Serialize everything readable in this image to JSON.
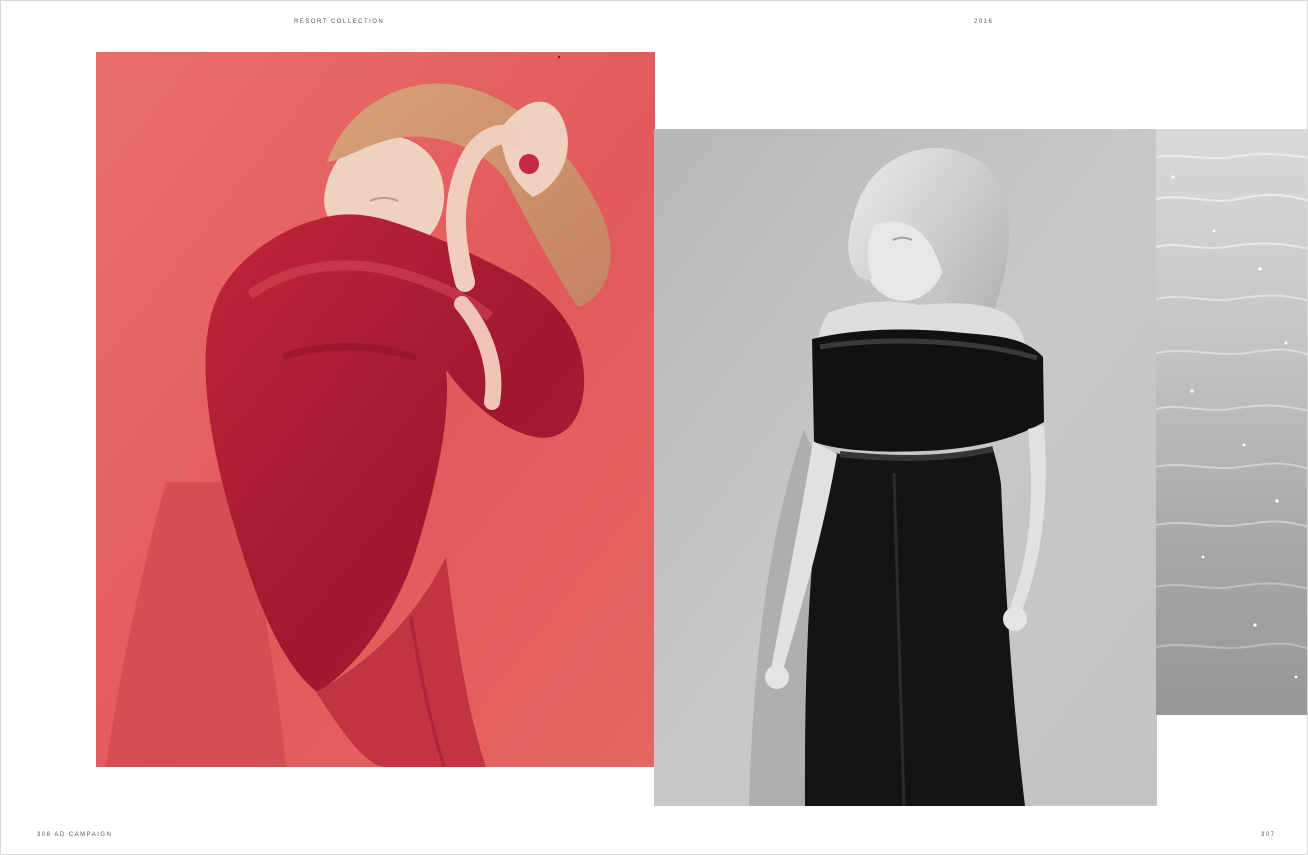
{
  "header": {
    "collection": "RESORT COLLECTION",
    "year": "2016"
  },
  "footer": {
    "left_folio": "306 AD CAMPAIGN",
    "right_folio": "307"
  },
  "colors": {
    "accent_red": "#e2585a",
    "garment_red": "#b51f35",
    "monochrome_gray": "#c5c5c5"
  }
}
